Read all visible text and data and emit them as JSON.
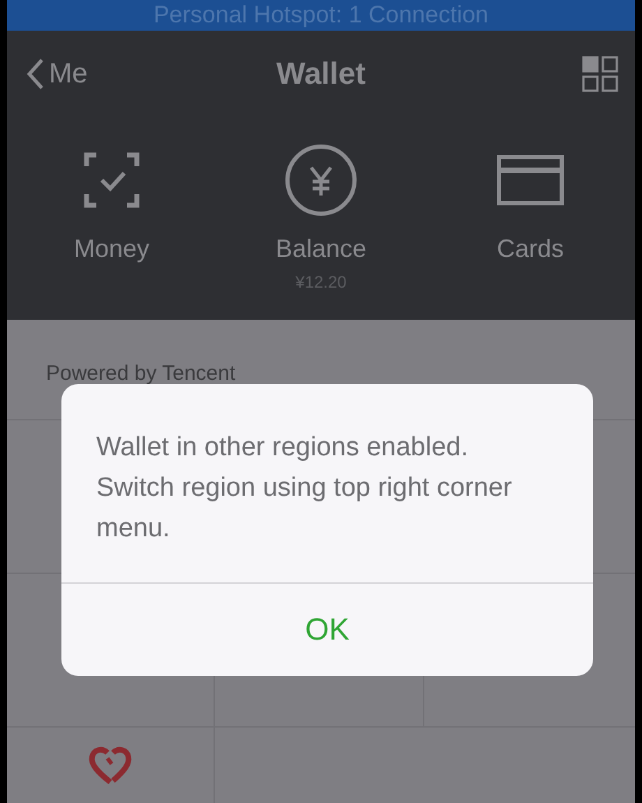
{
  "status_bar": {
    "text": "Personal Hotspot: 1 Connection"
  },
  "nav": {
    "back": "Me",
    "title": "Wallet"
  },
  "header_items": [
    {
      "kind": "money",
      "label": "Money"
    },
    {
      "kind": "balance",
      "label": "Balance",
      "amount": "¥12.20"
    },
    {
      "kind": "cards",
      "label": "Cards"
    }
  ],
  "footer_note": "Powered by Tencent",
  "dialog": {
    "message": "Wallet in other regions enabled. Switch region using top right corner menu.",
    "button": "OK"
  }
}
